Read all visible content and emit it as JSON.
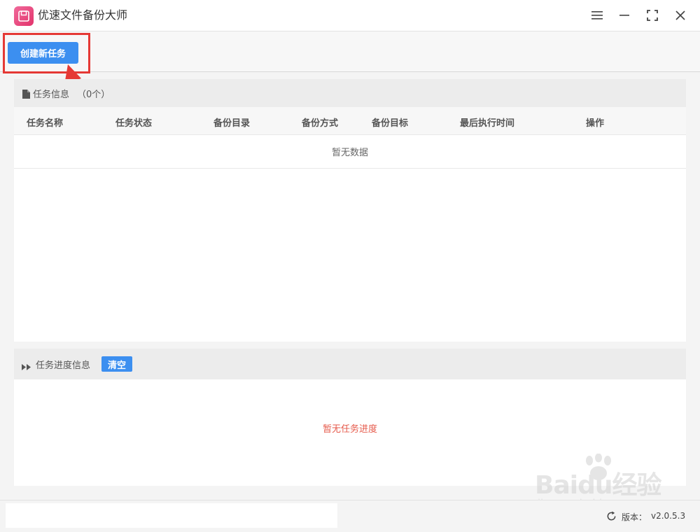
{
  "window": {
    "title": "优速文件备份大师",
    "controls": [
      "menu-icon",
      "minimize-icon",
      "maximize-icon",
      "close-icon"
    ]
  },
  "toolbar": {
    "create_task_label": "创建新任务"
  },
  "task_panel": {
    "title": "任务信息",
    "count": "（0个）",
    "columns": [
      "任务名称",
      "任务状态",
      "备份目录",
      "备份方式",
      "备份目标",
      "最后执行时间",
      "操作"
    ],
    "empty_text": "暂无数据"
  },
  "progress_panel": {
    "title": "任务进度信息",
    "clear_label": "清空",
    "empty_text": "暂无任务进度"
  },
  "status": {
    "version_label": "版本：",
    "version_value": "v2.0.5.3"
  },
  "watermark": {
    "brand": "Baidu经验",
    "url": "jingyan.baidu.com"
  },
  "colors": {
    "accent": "#3c8ff0",
    "logo": "#e2336b",
    "highlight": "#e53935",
    "empty_progress": "#e65a4b"
  }
}
